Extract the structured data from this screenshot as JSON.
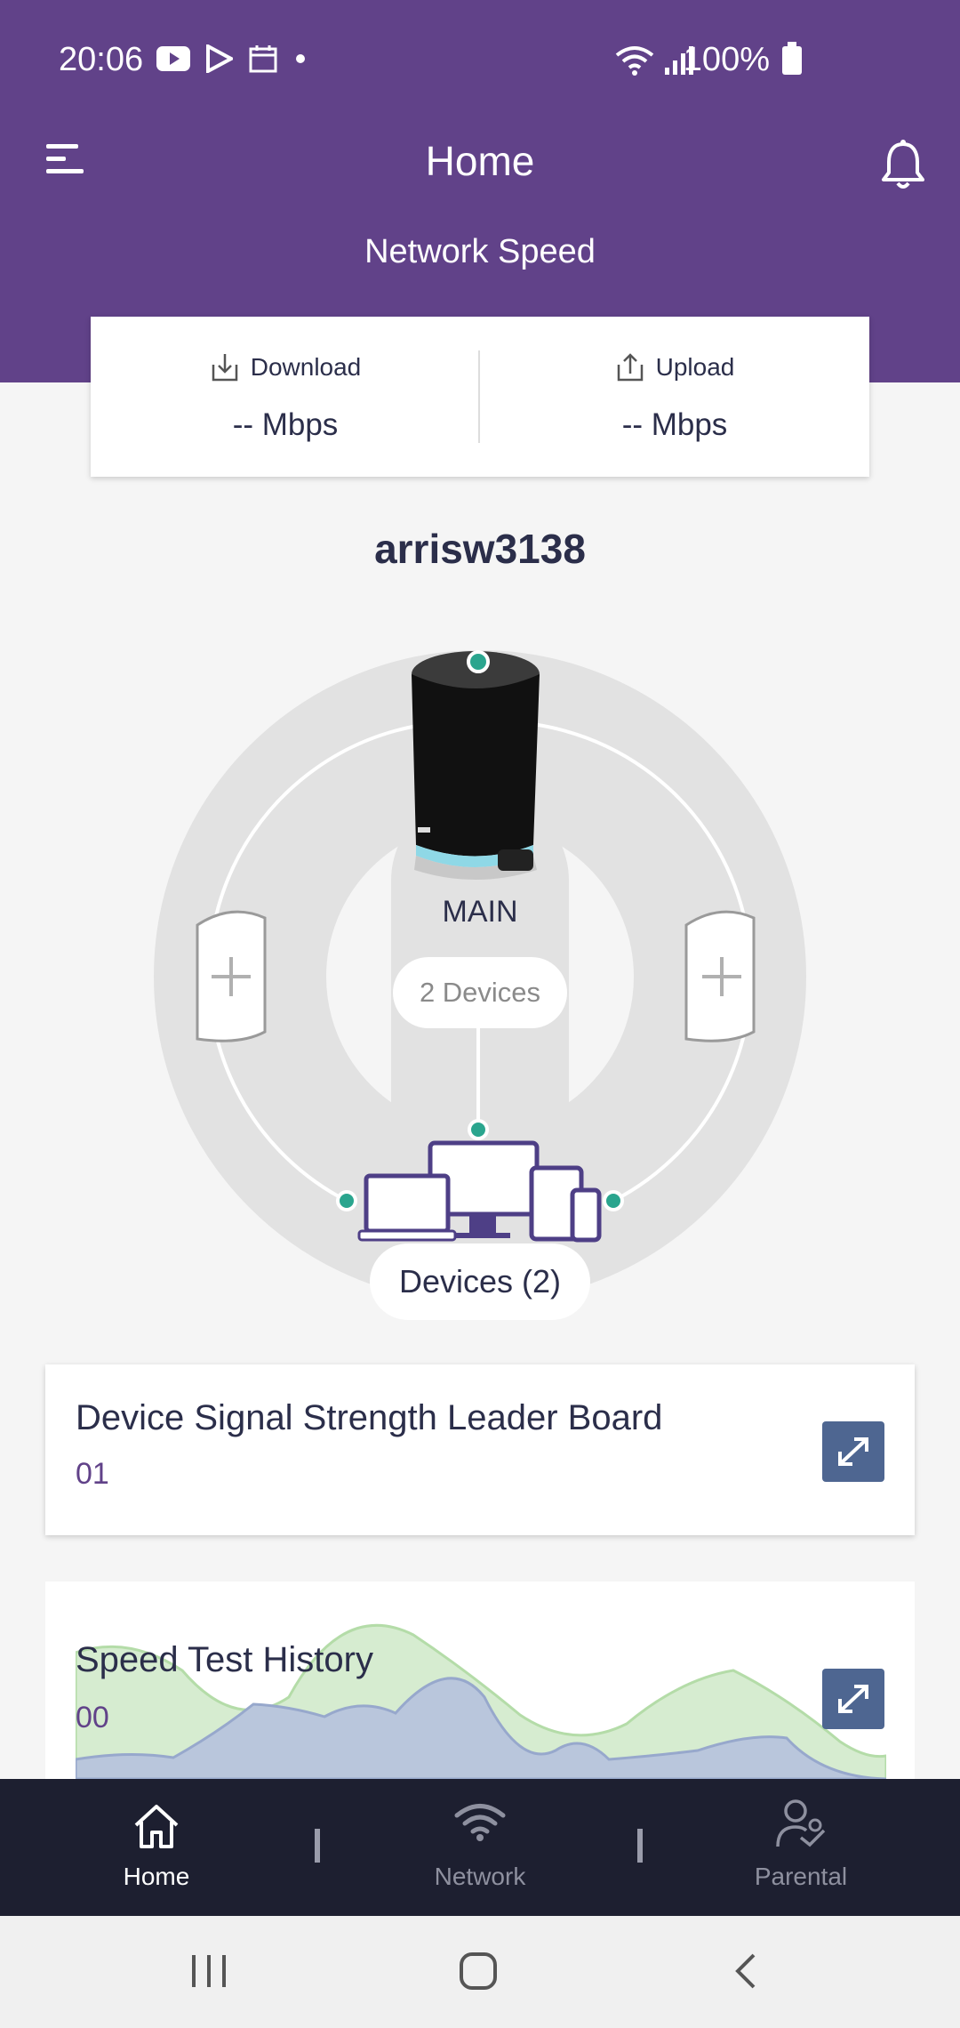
{
  "status_bar": {
    "time": "20:06",
    "battery": "100%"
  },
  "header": {
    "title": "Home",
    "subtitle": "Network Speed"
  },
  "speed": {
    "download_label": "Download",
    "download_value": "-- Mbps",
    "upload_label": "Upload",
    "upload_value": "-- Mbps"
  },
  "network": {
    "name": "arrisw3138",
    "main_label": "MAIN",
    "main_devices": "2 Devices",
    "devices_pill": "Devices (2)"
  },
  "cards": {
    "leaderboard": {
      "title": "Device Signal Strength Leader Board",
      "value": "01"
    },
    "speed_history": {
      "title": "Speed Test History",
      "value": "00"
    }
  },
  "bottom_nav": {
    "home": "Home",
    "network": "Network",
    "parental": "Parental"
  },
  "colors": {
    "brand": "#614289",
    "nav_bg": "#1d1f30",
    "accent_dot": "#2aa58e",
    "expand_btn": "#4e6691"
  },
  "icons": [
    "menu-icon",
    "bell-icon",
    "download-icon",
    "upload-icon",
    "add-satellite-icon",
    "router-icon",
    "devices-icon",
    "expand-icon",
    "home-icon",
    "wifi-icon",
    "parental-icon"
  ]
}
